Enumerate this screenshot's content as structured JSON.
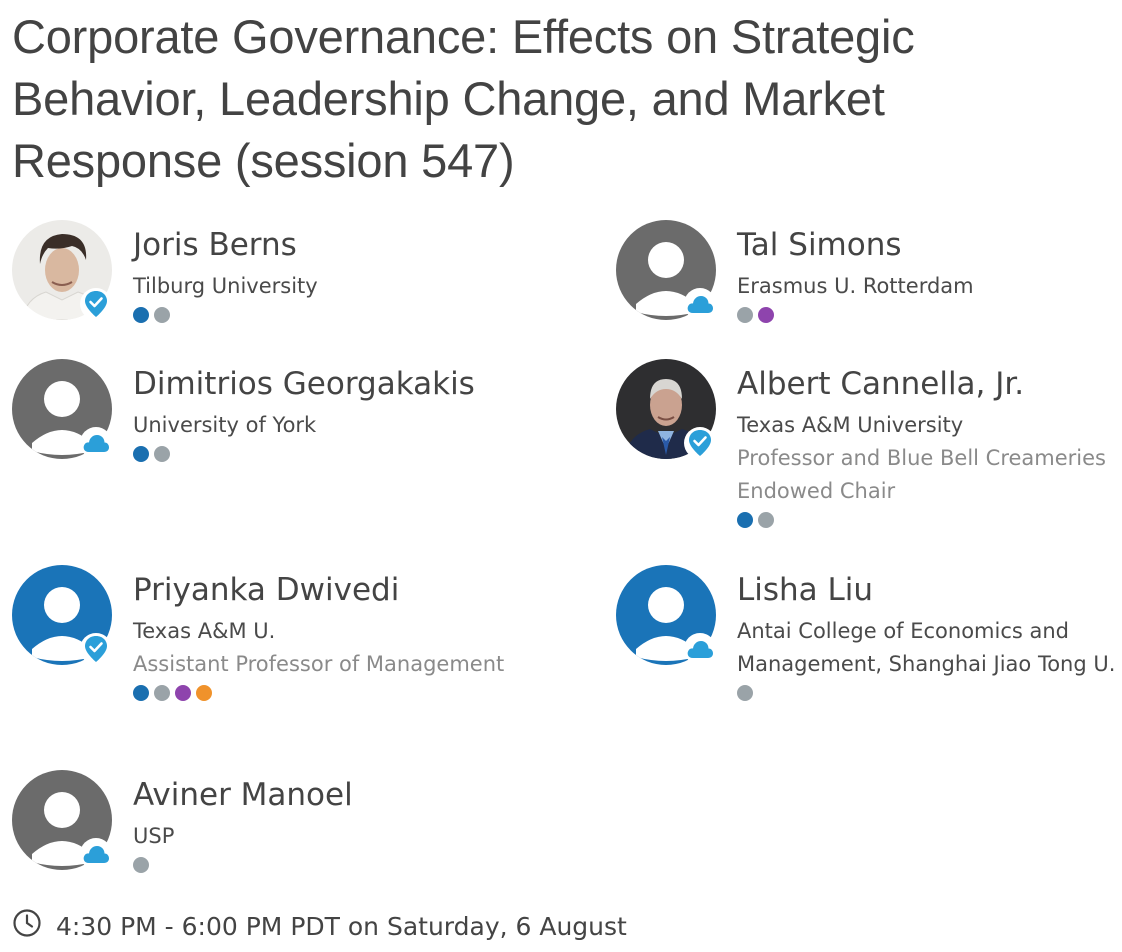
{
  "session": {
    "title": "Corporate Governance: Effects on Strategic Behavior, Leadership Change, and Market Response (session 547)",
    "time": "4:30 PM - 6:00 PM PDT on Saturday, 6 August"
  },
  "colors": {
    "dot_blue": "#1a6fb0",
    "dot_gray": "#9aa3a8",
    "dot_purple": "#8e44ad",
    "dot_orange": "#f0922b",
    "badge_blue": "#2b9fd9",
    "placeholder_gray": "#6b6b6b",
    "placeholder_blue": "#1a74b8"
  },
  "speakers": [
    {
      "name": "Joris Berns",
      "affiliation": "Tilburg University",
      "role": "",
      "avatar": "photo",
      "badge": "verified-icon",
      "dots": [
        "dot_blue",
        "dot_gray"
      ]
    },
    {
      "name": "Tal Simons",
      "affiliation": "Erasmus U. Rotterdam",
      "role": "",
      "avatar": "placeholder-gray",
      "badge": "cloud-icon",
      "dots": [
        "dot_gray",
        "dot_purple"
      ]
    },
    {
      "name": "Dimitrios Georgakakis",
      "affiliation": "University of York",
      "role": "",
      "avatar": "placeholder-gray",
      "badge": "cloud-icon",
      "dots": [
        "dot_blue",
        "dot_gray"
      ]
    },
    {
      "name": "Albert Cannella, Jr.",
      "affiliation": "Texas A&M University",
      "role": "Professor and Blue Bell Creameries Endowed Chair",
      "avatar": "photo",
      "badge": "verified-icon",
      "dots": [
        "dot_blue",
        "dot_gray"
      ]
    },
    {
      "name": "Priyanka Dwivedi",
      "affiliation": "Texas A&M U.",
      "role": "Assistant Professor of Management",
      "avatar": "placeholder-blue",
      "badge": "verified-icon",
      "dots": [
        "dot_blue",
        "dot_gray",
        "dot_purple",
        "dot_orange"
      ]
    },
    {
      "name": "Lisha Liu",
      "affiliation": "Antai College of Economics and Management, Shanghai Jiao Tong U.",
      "role": "",
      "avatar": "placeholder-blue",
      "badge": "cloud-icon",
      "dots": [
        "dot_gray"
      ]
    },
    {
      "name": "Aviner Manoel",
      "affiliation": "USP",
      "role": "",
      "avatar": "placeholder-gray",
      "badge": "cloud-icon",
      "dots": [
        "dot_gray"
      ]
    }
  ]
}
